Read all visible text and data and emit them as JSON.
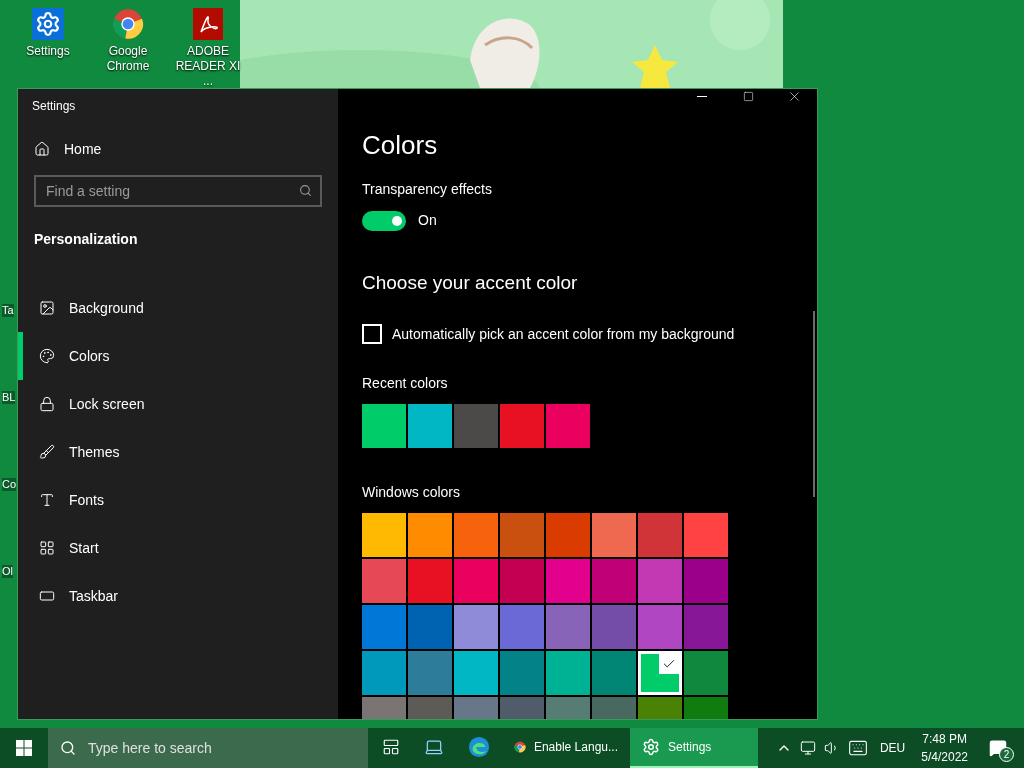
{
  "desktop": {
    "icons": [
      {
        "label": "Settings",
        "kind": "gear"
      },
      {
        "label": "Google Chrome",
        "kind": "chrome"
      },
      {
        "label": "ADOBE READER XI ...",
        "kind": "pdf"
      }
    ],
    "cut_labels": [
      {
        "text": "Ta"
      },
      {
        "text": "BL"
      },
      {
        "text": "Co"
      },
      {
        "text": "Ol"
      }
    ]
  },
  "window": {
    "title": "Settings"
  },
  "sidebar": {
    "home": "Home",
    "search": {
      "placeholder": "Find a setting"
    },
    "section": "Personalization",
    "items": [
      {
        "label": "Background",
        "kind": "background",
        "selected": false
      },
      {
        "label": "Colors",
        "kind": "colors",
        "selected": true
      },
      {
        "label": "Lock screen",
        "kind": "lock",
        "selected": false
      },
      {
        "label": "Themes",
        "kind": "themes",
        "selected": false
      },
      {
        "label": "Fonts",
        "kind": "fonts",
        "selected": false
      },
      {
        "label": "Start",
        "kind": "start",
        "selected": false
      },
      {
        "label": "Taskbar",
        "kind": "taskbar",
        "selected": false
      }
    ]
  },
  "content": {
    "title": "Colors",
    "transparency": {
      "label": "Transparency effects",
      "on": true,
      "state_text": "On"
    },
    "accent_heading": "Choose your accent color",
    "auto_pick": {
      "label": "Automatically pick an accent color from my background",
      "checked": false
    },
    "recent": {
      "label": "Recent colors",
      "colors": [
        {
          "color": "#00cc6a"
        },
        {
          "color": "#00b7c3"
        },
        {
          "color": "#4c4a48"
        },
        {
          "color": "#e81123"
        },
        {
          "color": "#ea005e"
        }
      ]
    },
    "windows_colors": {
      "label": "Windows colors",
      "swatches": [
        {
          "color": "#ffb900",
          "selected": false
        },
        {
          "color": "#ff8c00",
          "selected": false
        },
        {
          "color": "#f7630c",
          "selected": false
        },
        {
          "color": "#ca5010",
          "selected": false
        },
        {
          "color": "#da3b01",
          "selected": false
        },
        {
          "color": "#ef6950",
          "selected": false
        },
        {
          "color": "#d13438",
          "selected": false
        },
        {
          "color": "#ff4343",
          "selected": false
        },
        {
          "color": "#e74856",
          "selected": false
        },
        {
          "color": "#e81123",
          "selected": false
        },
        {
          "color": "#ea005e",
          "selected": false
        },
        {
          "color": "#c30052",
          "selected": false
        },
        {
          "color": "#e3008c",
          "selected": false
        },
        {
          "color": "#bf0077",
          "selected": false
        },
        {
          "color": "#c239b3",
          "selected": false
        },
        {
          "color": "#9a0089",
          "selected": false
        },
        {
          "color": "#0078d7",
          "selected": false
        },
        {
          "color": "#0063b1",
          "selected": false
        },
        {
          "color": "#8e8cd8",
          "selected": false
        },
        {
          "color": "#6b69d6",
          "selected": false
        },
        {
          "color": "#8764b8",
          "selected": false
        },
        {
          "color": "#744da9",
          "selected": false
        },
        {
          "color": "#b146c2",
          "selected": false
        },
        {
          "color": "#881798",
          "selected": false
        },
        {
          "color": "#0099bc",
          "selected": false
        },
        {
          "color": "#2d7d9a",
          "selected": false
        },
        {
          "color": "#00b7c3",
          "selected": false
        },
        {
          "color": "#038387",
          "selected": false
        },
        {
          "color": "#00b294",
          "selected": false
        },
        {
          "color": "#018574",
          "selected": false
        },
        {
          "color": "#00cc6a",
          "selected": true
        },
        {
          "color": "#10893e",
          "selected": false
        },
        {
          "color": "#7a7574",
          "selected": false
        },
        {
          "color": "#5d5a58",
          "selected": false
        },
        {
          "color": "#68768a",
          "selected": false
        },
        {
          "color": "#515c6b",
          "selected": false
        },
        {
          "color": "#567c73",
          "selected": false
        },
        {
          "color": "#486860",
          "selected": false
        },
        {
          "color": "#498205",
          "selected": false
        },
        {
          "color": "#107c10",
          "selected": false
        }
      ]
    }
  },
  "taskbar": {
    "search": {
      "placeholder": "Type here to search"
    },
    "apps": [
      {
        "kind": "taskview",
        "active": false
      },
      {
        "kind": "computer",
        "active": false
      },
      {
        "kind": "edge",
        "active": false
      },
      {
        "kind": "chrome",
        "label": "Enable Langu...",
        "active": false
      },
      {
        "kind": "gear",
        "label": "Settings",
        "active": true
      }
    ],
    "language": "DEU",
    "time": "7:48 PM",
    "date": "5/4/2022",
    "notifications": "2"
  }
}
